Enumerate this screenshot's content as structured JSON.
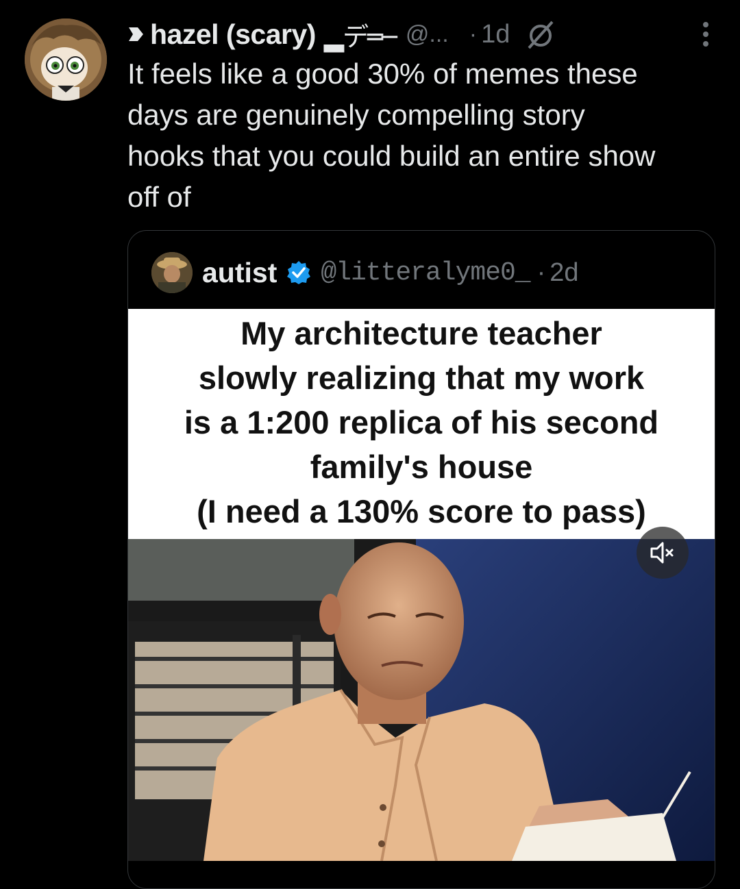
{
  "tweet": {
    "display_name": "hazel (scary)",
    "name_decoration": "▂デ═─",
    "handle": "@...",
    "dot": "·",
    "time": "1d",
    "text_lines": [
      "It feels like a good 30% of memes these",
      "days are genuinely compelling story",
      "hooks that you could build an entire show",
      "off of"
    ]
  },
  "quote": {
    "display_name": "autist",
    "handle": "@litteralyme0_",
    "dot": "·",
    "time": "2d",
    "caption_lines": [
      "My architecture teacher",
      "slowly realizing that my work",
      "is a 1:200 replica of his second",
      "family's house",
      "(I need a 130% score to pass)"
    ]
  },
  "icons": [
    "avatar",
    "leaf-icon",
    "null-set-icon",
    "more-vertical-icon",
    "verified-badge-icon",
    "mute-icon"
  ],
  "colors": {
    "background": "#000000",
    "text": "#e7e9ea",
    "secondary": "#71767b",
    "verified": "#1d9bf0"
  }
}
